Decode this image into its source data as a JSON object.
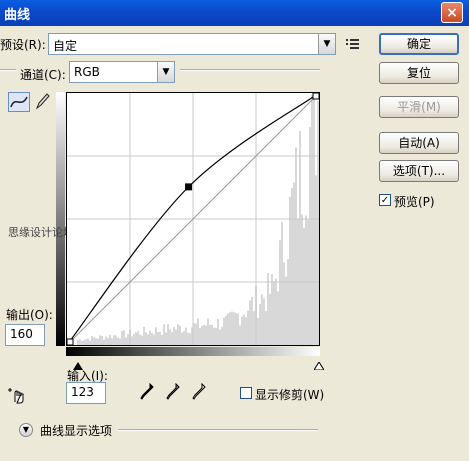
{
  "window": {
    "title": "曲线",
    "close_icon": "close-icon"
  },
  "preset": {
    "label": "预设(R):",
    "value": "自定",
    "menu_icon": "preset-menu-icon"
  },
  "channel": {
    "label": "通道(C):",
    "value": "RGB"
  },
  "buttons": {
    "ok": "确定",
    "reset": "复位",
    "smooth": "平滑(M)",
    "auto": "自动(A)",
    "options": "选项(T)..."
  },
  "preview": {
    "label": "预览(P)",
    "checked": true
  },
  "tools": {
    "curve_tool_icon": "curve-tool-icon",
    "pencil_tool_icon": "pencil-icon",
    "target_adjust_icon": "hand-adjust-icon"
  },
  "output": {
    "label": "输出(O):",
    "value": "160"
  },
  "input": {
    "label": "输入(I):",
    "value": "123"
  },
  "clipping": {
    "label": "显示修剪(W)",
    "checked": false
  },
  "curve_display": {
    "label": "曲线显示选项",
    "toggle_icon": "chevron-down-circle-icon"
  },
  "watermark": "思缘设计论坛 www.MISSYUAN.COM",
  "chart_data": {
    "type": "line",
    "xlim": [
      0,
      255
    ],
    "ylim": [
      0,
      255
    ],
    "grid": "4x4",
    "curve_points": [
      [
        0,
        0
      ],
      [
        123,
        160
      ],
      [
        255,
        255
      ]
    ],
    "baseline": [
      [
        0,
        0
      ],
      [
        255,
        255
      ]
    ],
    "selected_point": [
      123,
      160
    ]
  }
}
